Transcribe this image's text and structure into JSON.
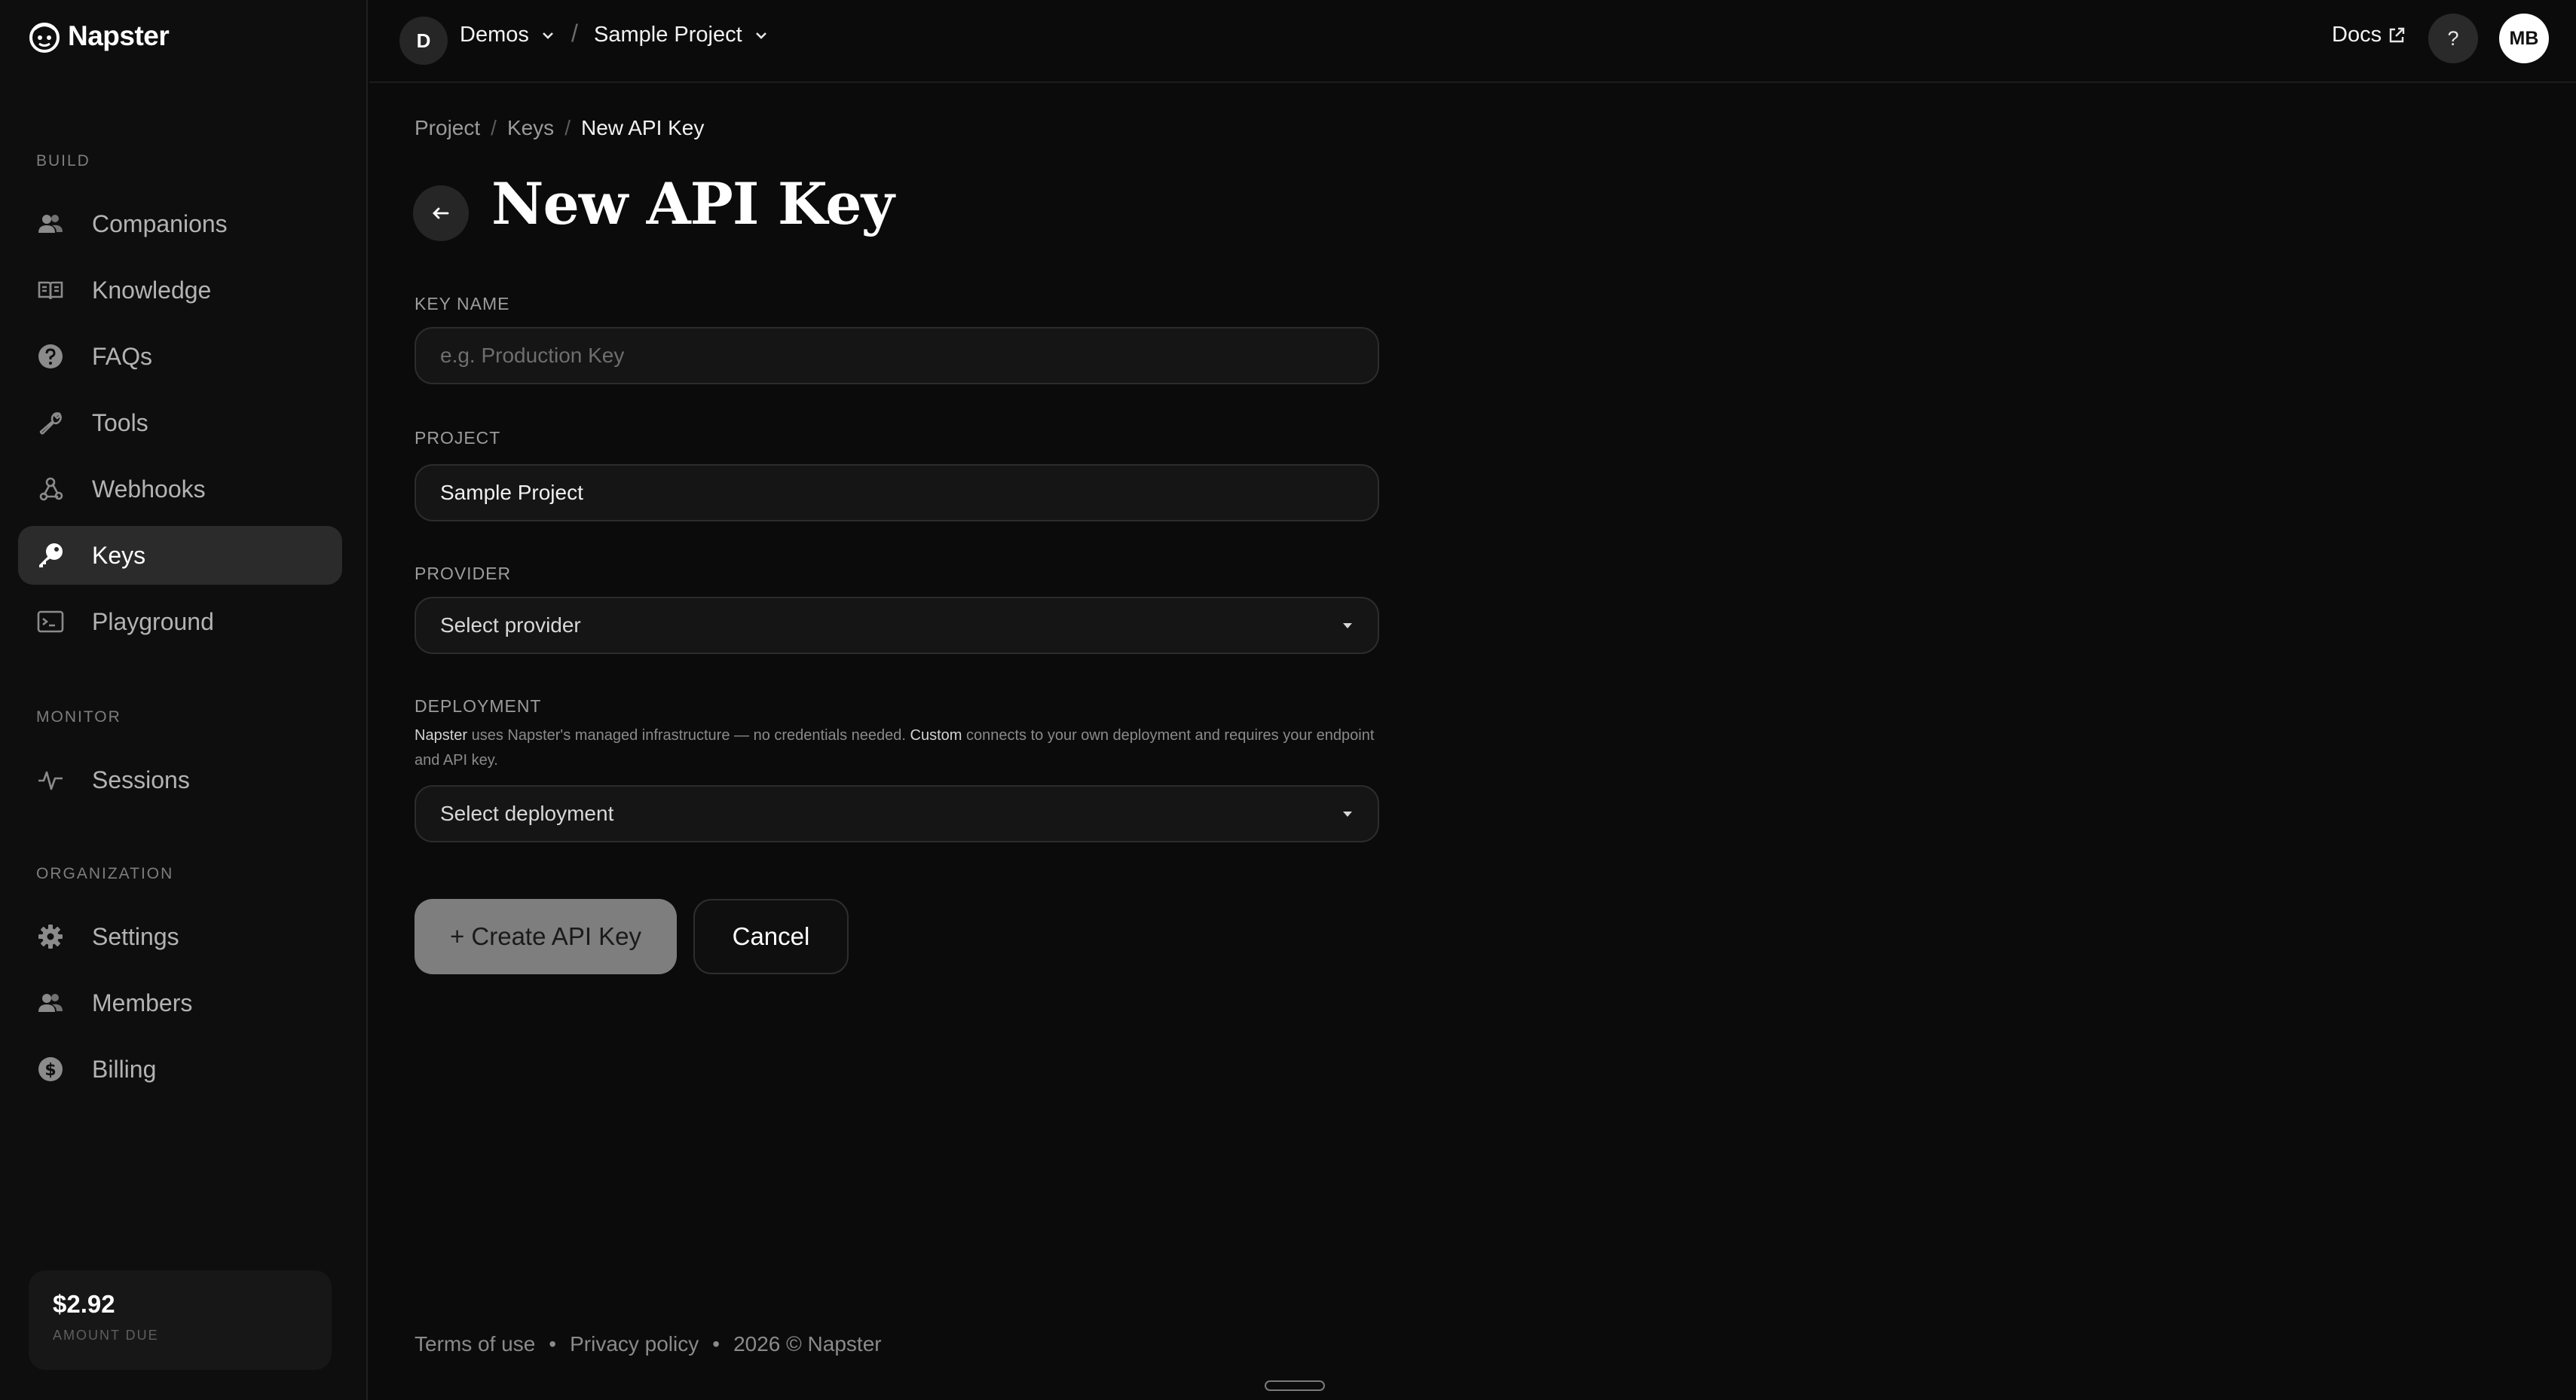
{
  "brand": {
    "name": "Napster",
    "logo_icon": "napster-logo-icon"
  },
  "sidebar": {
    "sections": [
      {
        "title": "BUILD"
      },
      {
        "title": "MONITOR"
      },
      {
        "title": "ORGANIZATION"
      }
    ],
    "items": [
      {
        "label": "Companions",
        "icon": "users-icon"
      },
      {
        "label": "Knowledge",
        "icon": "book-icon"
      },
      {
        "label": "FAQs",
        "icon": "question-circle-icon"
      },
      {
        "label": "Tools",
        "icon": "wrench-icon"
      },
      {
        "label": "Webhooks",
        "icon": "webhook-icon"
      },
      {
        "label": "Keys",
        "icon": "key-icon",
        "active": true
      },
      {
        "label": "Playground",
        "icon": "terminal-icon"
      },
      {
        "label": "Sessions",
        "icon": "activity-icon"
      },
      {
        "label": "Settings",
        "icon": "gear-icon"
      },
      {
        "label": "Members",
        "icon": "users-icon"
      },
      {
        "label": "Billing",
        "icon": "dollar-circle-icon"
      }
    ],
    "balance": {
      "amount": "$2.92",
      "caption": "AMOUNT DUE"
    }
  },
  "topbar": {
    "org_initial": "D",
    "org_name": "Demos",
    "separator": "/",
    "project_name": "Sample Project",
    "docs_label": "Docs",
    "help_label": "?",
    "user_initials": "MB"
  },
  "breadcrumb": {
    "items": [
      "Project",
      "Keys",
      "New API Key"
    ],
    "separator": "/"
  },
  "page": {
    "title": "New API Key"
  },
  "form": {
    "key_name": {
      "label": "KEY NAME",
      "placeholder": "e.g. Production Key",
      "value": ""
    },
    "project": {
      "label": "PROJECT",
      "value": "Sample Project"
    },
    "provider": {
      "label": "PROVIDER",
      "value": "Select provider"
    },
    "deployment": {
      "label": "DEPLOYMENT",
      "help_strong_1": "Napster",
      "help_text_1": " uses Napster's managed infrastructure — no credentials needed. ",
      "help_strong_2": "Custom",
      "help_text_2": " connects to your own deployment and requires your endpoint and API key.",
      "value": "Select deployment"
    },
    "create_label": "+ Create API Key",
    "cancel_label": "Cancel"
  },
  "footer": {
    "terms": "Terms of use",
    "dot": "•",
    "privacy": "Privacy policy",
    "copyright": "2026 © Napster"
  },
  "colors": {
    "background": "#0b0b0b",
    "sidebar": "#0e0e0e",
    "active_item": "#2b2b2b",
    "primary_button": "#7e7e7e"
  }
}
